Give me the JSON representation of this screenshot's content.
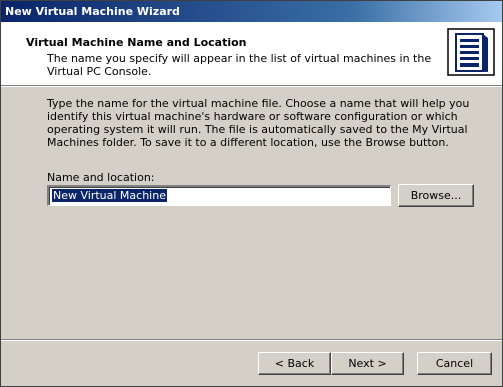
{
  "window": {
    "title": "New Virtual Machine Wizard"
  },
  "header": {
    "title": "Virtual Machine Name and Location",
    "subtitle": "The name you specify will appear in the list of virtual machines in the Virtual PC Console.",
    "icon": "virtual-pc-server-icon"
  },
  "body": {
    "description": "Type the name for the virtual machine file. Choose a name that will help you identify this virtual machine's hardware or software configuration or which operating system it will run. The file is automatically saved to the My Virtual Machines folder. To save it to a different location, use the Browse button."
  },
  "form": {
    "name_label": "Name and location:",
    "name_value": "New Virtual Machine",
    "browse_label": "Browse..."
  },
  "footer": {
    "back_label": "< Back",
    "next_label": "Next >",
    "cancel_label": "Cancel"
  },
  "colors": {
    "title_bar": "#0a246a",
    "dialog_bg": "#d4d0c8",
    "header_bg": "#ffffff",
    "selection": "#0a246a"
  }
}
